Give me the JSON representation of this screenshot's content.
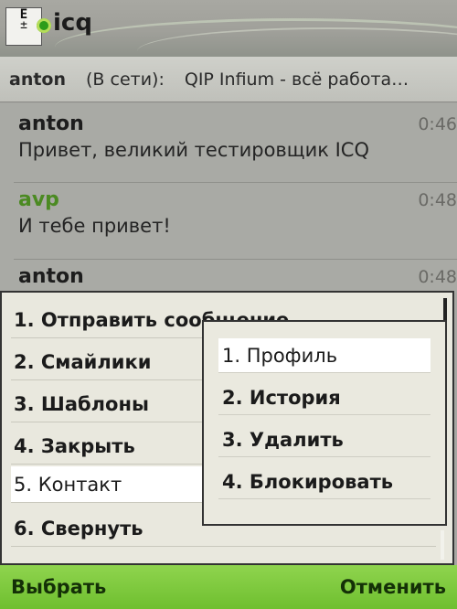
{
  "app": {
    "title": "icq",
    "logo_text": [
      "E",
      "±"
    ]
  },
  "contact_header": {
    "name": "anton",
    "status": "(В сети):",
    "status_message": "QIP Infium - всё работа…"
  },
  "messages": [
    {
      "author": "anton",
      "time": "0:46",
      "text": "Привет, великий тестировщик ICQ"
    },
    {
      "author": "avp",
      "time": "0:48",
      "text": "И тебе привет!"
    },
    {
      "author": "anton",
      "time": "0:48",
      "text": ""
    }
  ],
  "menu": {
    "items": [
      {
        "label": "1. Отправить сообщение"
      },
      {
        "label": "2. Смайлики"
      },
      {
        "label": "3. Шаблоны"
      },
      {
        "label": "4. Закрыть"
      },
      {
        "label": "5. Контакт"
      },
      {
        "label": "6. Свернуть"
      }
    ],
    "selected_index": 4
  },
  "submenu": {
    "items": [
      {
        "label": "1. Профиль"
      },
      {
        "label": "2. История"
      },
      {
        "label": "3. Удалить"
      },
      {
        "label": "4. Блокировать"
      }
    ],
    "selected_index": 0
  },
  "softkeys": {
    "left": "Выбрать",
    "right": "Отменить"
  },
  "colors": {
    "softkey_bg": "#7cc83b",
    "accent_author": "#4b8a22",
    "menu_bg": "#e9e8de"
  }
}
